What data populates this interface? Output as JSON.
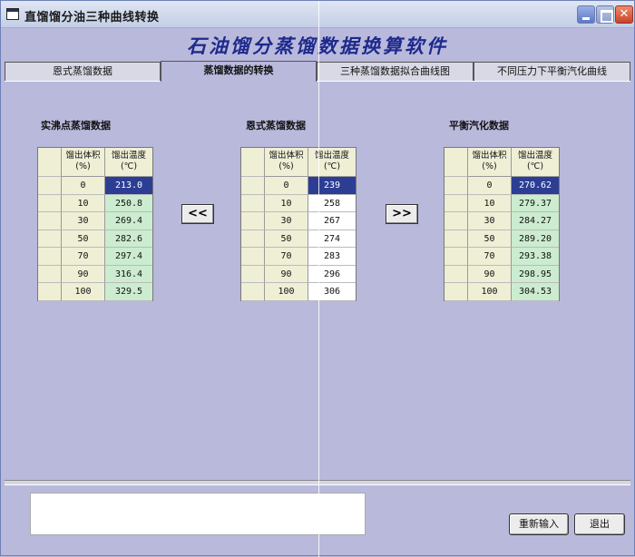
{
  "window": {
    "title": "直馏馏分油三种曲线转换"
  },
  "app": {
    "heading": "石油馏分蒸馏数据换算软件"
  },
  "tabs": [
    {
      "label": "恩式蒸馏数据"
    },
    {
      "label": "蒸馏数据的转换"
    },
    {
      "label": "三种蒸馏数据拟合曲线图"
    },
    {
      "label": "不同压力下平衡汽化曲线"
    }
  ],
  "active_tab": 1,
  "column_headers": {
    "volume": "馏出体积\n(%)",
    "temperature": "馏出温度\n(℃)"
  },
  "tables": [
    {
      "title": "实沸点蒸馏数据",
      "rows": [
        {
          "volume": "0",
          "temp": "213.0"
        },
        {
          "volume": "10",
          "temp": "250.8"
        },
        {
          "volume": "30",
          "temp": "269.4"
        },
        {
          "volume": "50",
          "temp": "282.6"
        },
        {
          "volume": "70",
          "temp": "297.4"
        },
        {
          "volume": "90",
          "temp": "316.4"
        },
        {
          "volume": "100",
          "temp": "329.5"
        }
      ]
    },
    {
      "title": "恩式蒸馏数据",
      "rows": [
        {
          "volume": "0",
          "temp": "239"
        },
        {
          "volume": "10",
          "temp": "258"
        },
        {
          "volume": "30",
          "temp": "267"
        },
        {
          "volume": "50",
          "temp": "274"
        },
        {
          "volume": "70",
          "temp": "283"
        },
        {
          "volume": "90",
          "temp": "296"
        },
        {
          "volume": "100",
          "temp": "306"
        }
      ]
    },
    {
      "title": "平衡汽化数据",
      "rows": [
        {
          "volume": "0",
          "temp": "270.62"
        },
        {
          "volume": "10",
          "temp": "279.37"
        },
        {
          "volume": "30",
          "temp": "284.27"
        },
        {
          "volume": "50",
          "temp": "289.20"
        },
        {
          "volume": "70",
          "temp": "293.38"
        },
        {
          "volume": "90",
          "temp": "298.95"
        },
        {
          "volume": "100",
          "temp": "304.53"
        }
      ]
    }
  ],
  "buttons": {
    "convert_left": "<<",
    "convert_right": ">>",
    "reset": "重新输入",
    "exit": "退出"
  },
  "message_box": {
    "text": ""
  }
}
